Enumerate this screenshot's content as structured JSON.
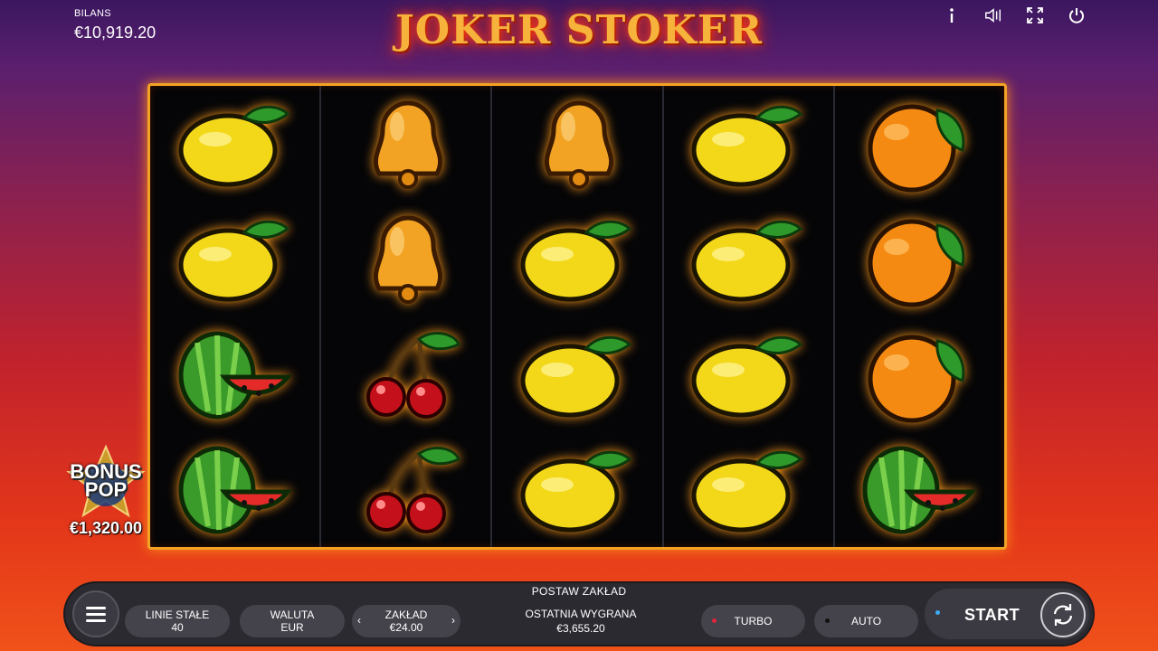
{
  "balance": {
    "label": "BILANS",
    "value": "€10,919.20"
  },
  "game_title": "JOKER STOKER",
  "top_icons": [
    "info-icon",
    "sound-icon",
    "fullscreen-icon",
    "power-icon"
  ],
  "reels": [
    [
      "lemon",
      "lemon",
      "watermelon",
      "watermelon"
    ],
    [
      "bell",
      "bell",
      "cherry",
      "cherry"
    ],
    [
      "bell",
      "lemon",
      "lemon",
      "lemon"
    ],
    [
      "lemon",
      "lemon",
      "lemon",
      "lemon"
    ],
    [
      "orange",
      "orange",
      "orange",
      "watermelon"
    ]
  ],
  "bonus_pop": {
    "line1": "BONUS",
    "line2": "POP",
    "amount": "€1,320.00"
  },
  "panel": {
    "title": "POSTAW ZAKŁAD",
    "lines": {
      "label": "LINIE STAŁE",
      "value": "40"
    },
    "currency": {
      "label": "WALUTA",
      "value": "EUR"
    },
    "bet": {
      "label": "ZAKŁAD",
      "value": "€24.00"
    },
    "last_win": {
      "label": "OSTATNIA WYGRANA",
      "value": "€3,655.20"
    },
    "turbo": {
      "label": "TURBO",
      "dot_color": "#e0253a"
    },
    "auto": {
      "label": "AUTO",
      "dot_color": "#111111"
    },
    "start": {
      "label": "START"
    }
  },
  "colors": {
    "frame": "#f2a224",
    "panel": "#2b2a31",
    "accent_glow": "#ff8c1a"
  }
}
